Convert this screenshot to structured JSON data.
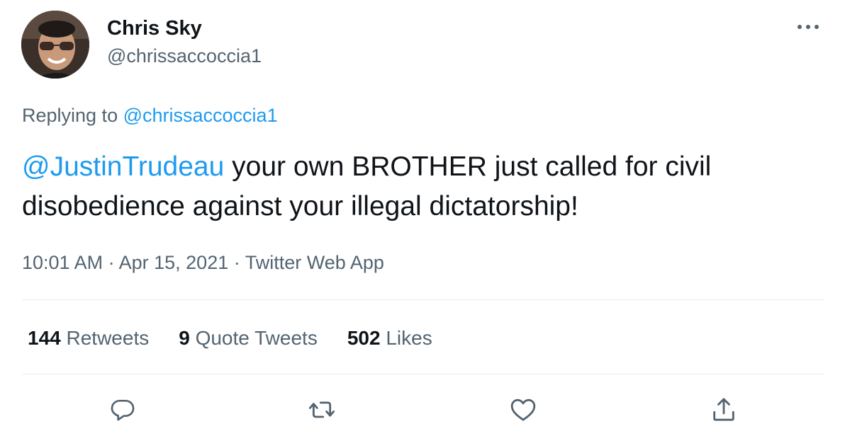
{
  "author": {
    "display_name": "Chris Sky",
    "handle": "@chrissaccoccia1"
  },
  "reply_context": {
    "prefix": "Replying to",
    "handle": "@chrissaccoccia1"
  },
  "tweet": {
    "mention": "@JustinTrudeau",
    "text": " your own BROTHER just called for civil disobedience against your illegal dictatorship!"
  },
  "meta": {
    "time": "10:01 AM",
    "separator": "·",
    "date": "Apr 15, 2021",
    "source": "Twitter Web App"
  },
  "stats": {
    "retweets_count": "144",
    "retweets_label": "Retweets",
    "quotes_count": "9",
    "quotes_label": "Quote Tweets",
    "likes_count": "502",
    "likes_label": "Likes"
  },
  "colors": {
    "link": "#1d9bf0",
    "secondary_text": "#536471",
    "primary_text": "#0f1419",
    "divider": "#e6ecf0"
  },
  "icons": {
    "more": "more-horizontal-icon",
    "reply": "reply-icon",
    "retweet": "retweet-icon",
    "like": "heart-icon",
    "share": "share-icon"
  }
}
